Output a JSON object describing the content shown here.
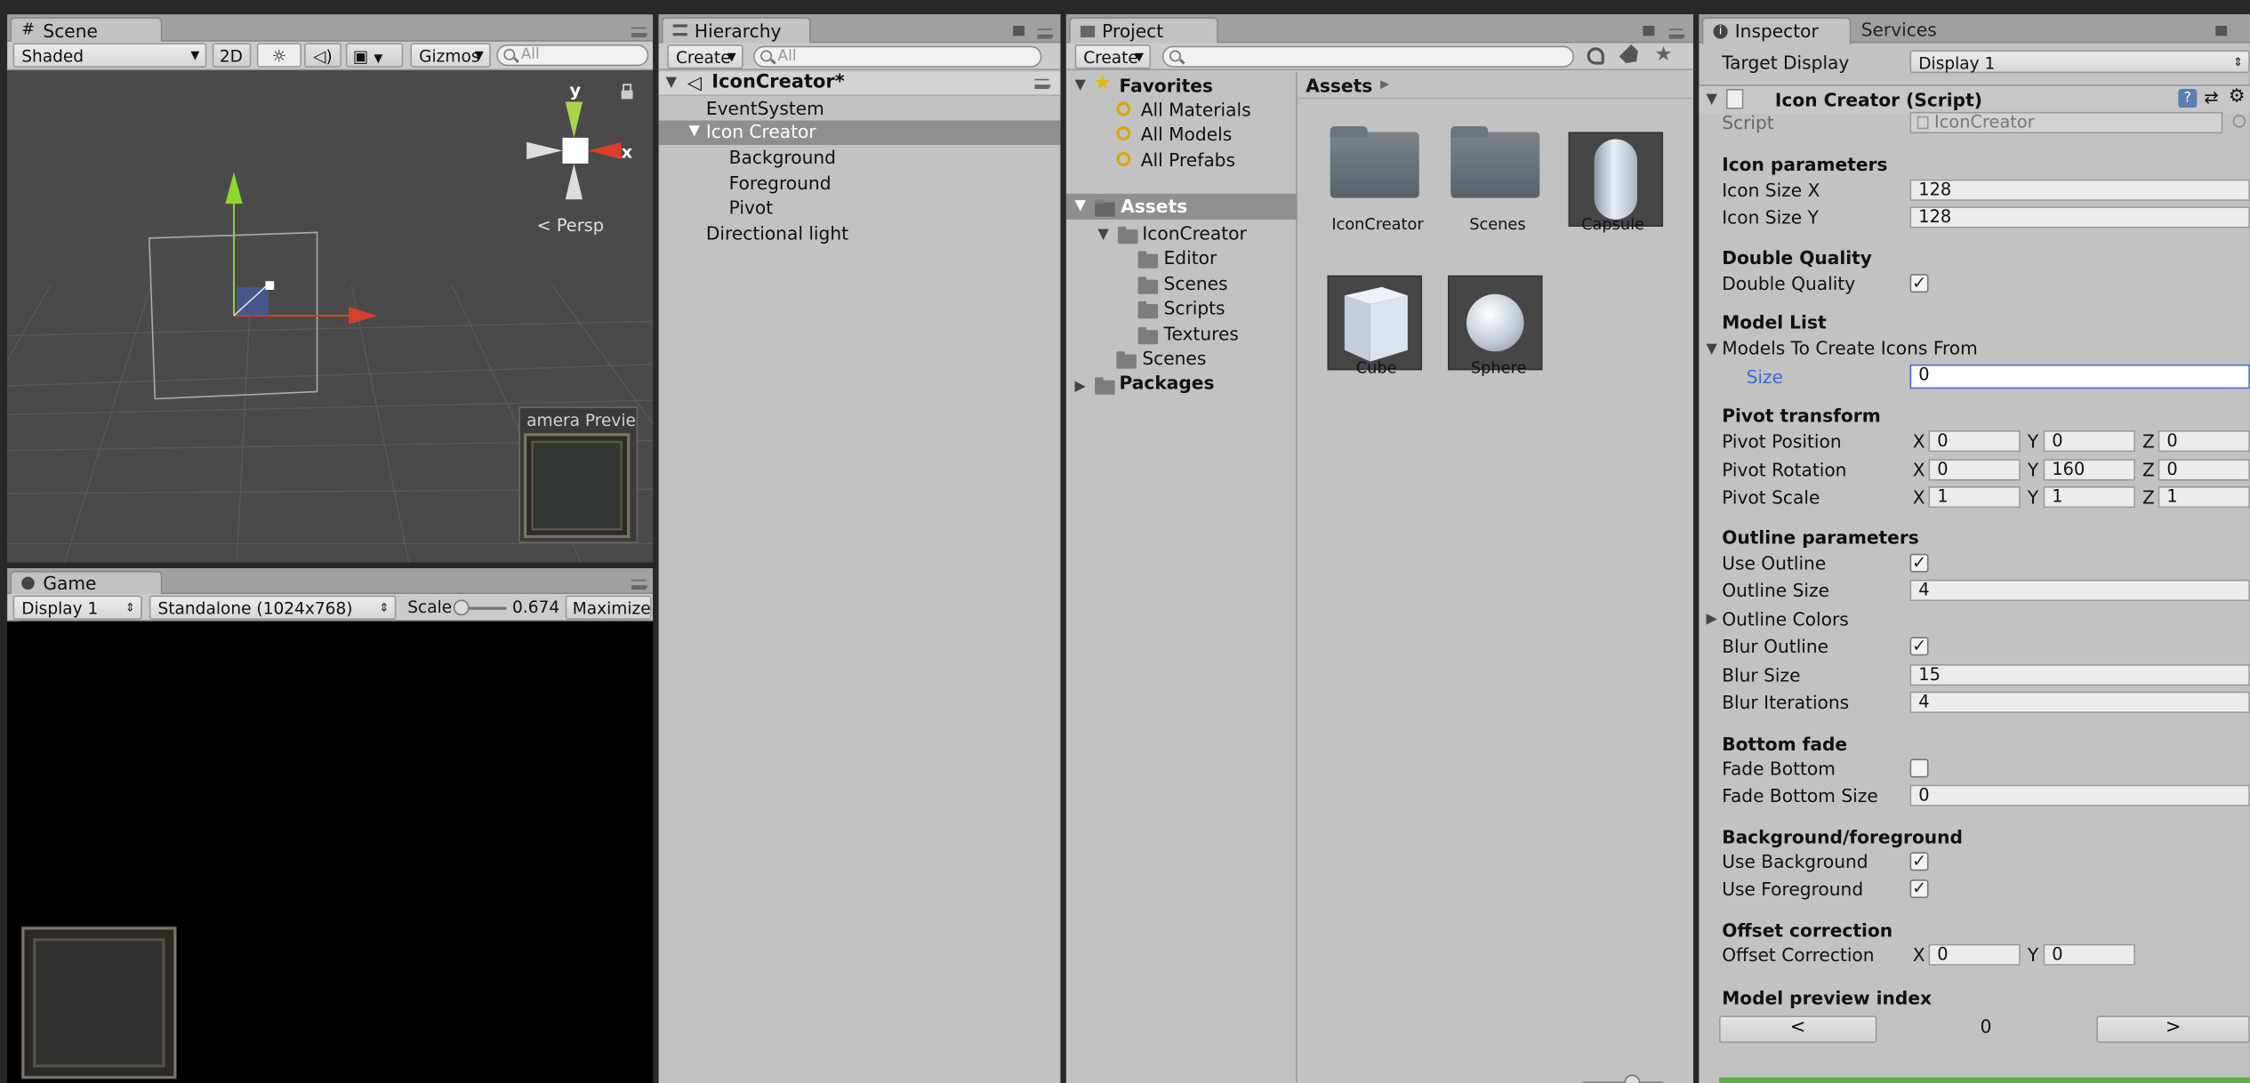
{
  "scene": {
    "tab": "Scene",
    "shading_mode": "Shaded",
    "mode_2d": "2D",
    "gizmos_label": "Gizmos",
    "search_placeholder": "All",
    "persp_label": "Persp",
    "axis_y": "y",
    "axis_x": "x",
    "camera_preview_label": "amera Previe"
  },
  "game": {
    "tab": "Game",
    "display": "Display 1",
    "resolution": "Standalone (1024x768)",
    "scale_label": "Scale",
    "scale_value": "0.674",
    "maximize_label": "Maximize O"
  },
  "hierarchy": {
    "tab": "Hierarchy",
    "create": "Create",
    "search_placeholder": "All",
    "scene_name": "IconCreator*",
    "items": [
      {
        "label": "EventSystem"
      },
      {
        "label": "Icon Creator"
      },
      {
        "label": "Background"
      },
      {
        "label": "Foreground"
      },
      {
        "label": "Pivot"
      },
      {
        "label": "Directional light"
      }
    ]
  },
  "project": {
    "tab": "Project",
    "create": "Create",
    "favorites": {
      "label": "Favorites",
      "items": [
        "All Materials",
        "All Models",
        "All Prefabs"
      ]
    },
    "assets_label": "Assets",
    "tree": [
      "IconCreator",
      "Editor",
      "Scenes",
      "Scripts",
      "Textures",
      "Scenes",
      "Packages"
    ],
    "breadcrumb": "Assets",
    "grid_items": [
      {
        "label": "IconCreator",
        "kind": "folder"
      },
      {
        "label": "Scenes",
        "kind": "folder"
      },
      {
        "label": "Capsule",
        "kind": "capsule"
      },
      {
        "label": "Cube",
        "kind": "cube"
      },
      {
        "label": "Sphere",
        "kind": "sphere"
      }
    ]
  },
  "inspector": {
    "tab": "Inspector",
    "tab_services": "Services",
    "target_display_label": "Target Display",
    "target_display_value": "Display 1",
    "component_title": "Icon Creator (Script)",
    "script_label": "Script",
    "script_value": "IconCreator",
    "sections": {
      "icon_params": "Icon parameters",
      "double_quality": "Double Quality",
      "model_list": "Model List",
      "pivot_transform": "Pivot transform",
      "outline_params": "Outline parameters",
      "bottom_fade": "Bottom fade",
      "bg_fg": "Background/foreground",
      "offset_correction": "Offset correction",
      "model_preview_index": "Model preview index"
    },
    "fields": {
      "icon_size_x_label": "Icon Size X",
      "icon_size_x": "128",
      "icon_size_y_label": "Icon Size Y",
      "icon_size_y": "128",
      "double_quality_label": "Double Quality",
      "models_label": "Models To Create Icons From",
      "size_label": "Size",
      "size_value": "0",
      "pivot_position_label": "Pivot Position",
      "pivot_rotation_label": "Pivot Rotation",
      "pivot_scale_label": "Pivot Scale",
      "pivot_position": {
        "x": "0",
        "y": "0",
        "z": "0"
      },
      "pivot_rotation": {
        "x": "0",
        "y": "160",
        "z": "0"
      },
      "pivot_scale": {
        "x": "1",
        "y": "1",
        "z": "1"
      },
      "use_outline_label": "Use Outline",
      "outline_size_label": "Outline Size",
      "outline_size": "4",
      "outline_colors_label": "Outline Colors",
      "blur_outline_label": "Blur Outline",
      "blur_size_label": "Blur Size",
      "blur_size": "15",
      "blur_iterations_label": "Blur Iterations",
      "blur_iterations": "4",
      "fade_bottom_label": "Fade Bottom",
      "fade_bottom_size_label": "Fade Bottom Size",
      "fade_bottom_size": "0",
      "use_background_label": "Use Background",
      "use_foreground_label": "Use Foreground",
      "offset_correction_label": "Offset Correction",
      "offset": {
        "x": "0",
        "y": "0"
      },
      "preview_index": "0",
      "prev_button": "<",
      "next_button": ">"
    },
    "axis_x": "X",
    "axis_y": "Y",
    "axis_z": "Z",
    "check_mark": "✓"
  },
  "colors": {
    "panel": "#c2c2c2",
    "selection": "#8f8f8f",
    "focused_field": "#3d6ad8",
    "x_axis": "#d8402a",
    "y_axis": "#8fd630",
    "grid_bg": "#4a4a4a"
  }
}
